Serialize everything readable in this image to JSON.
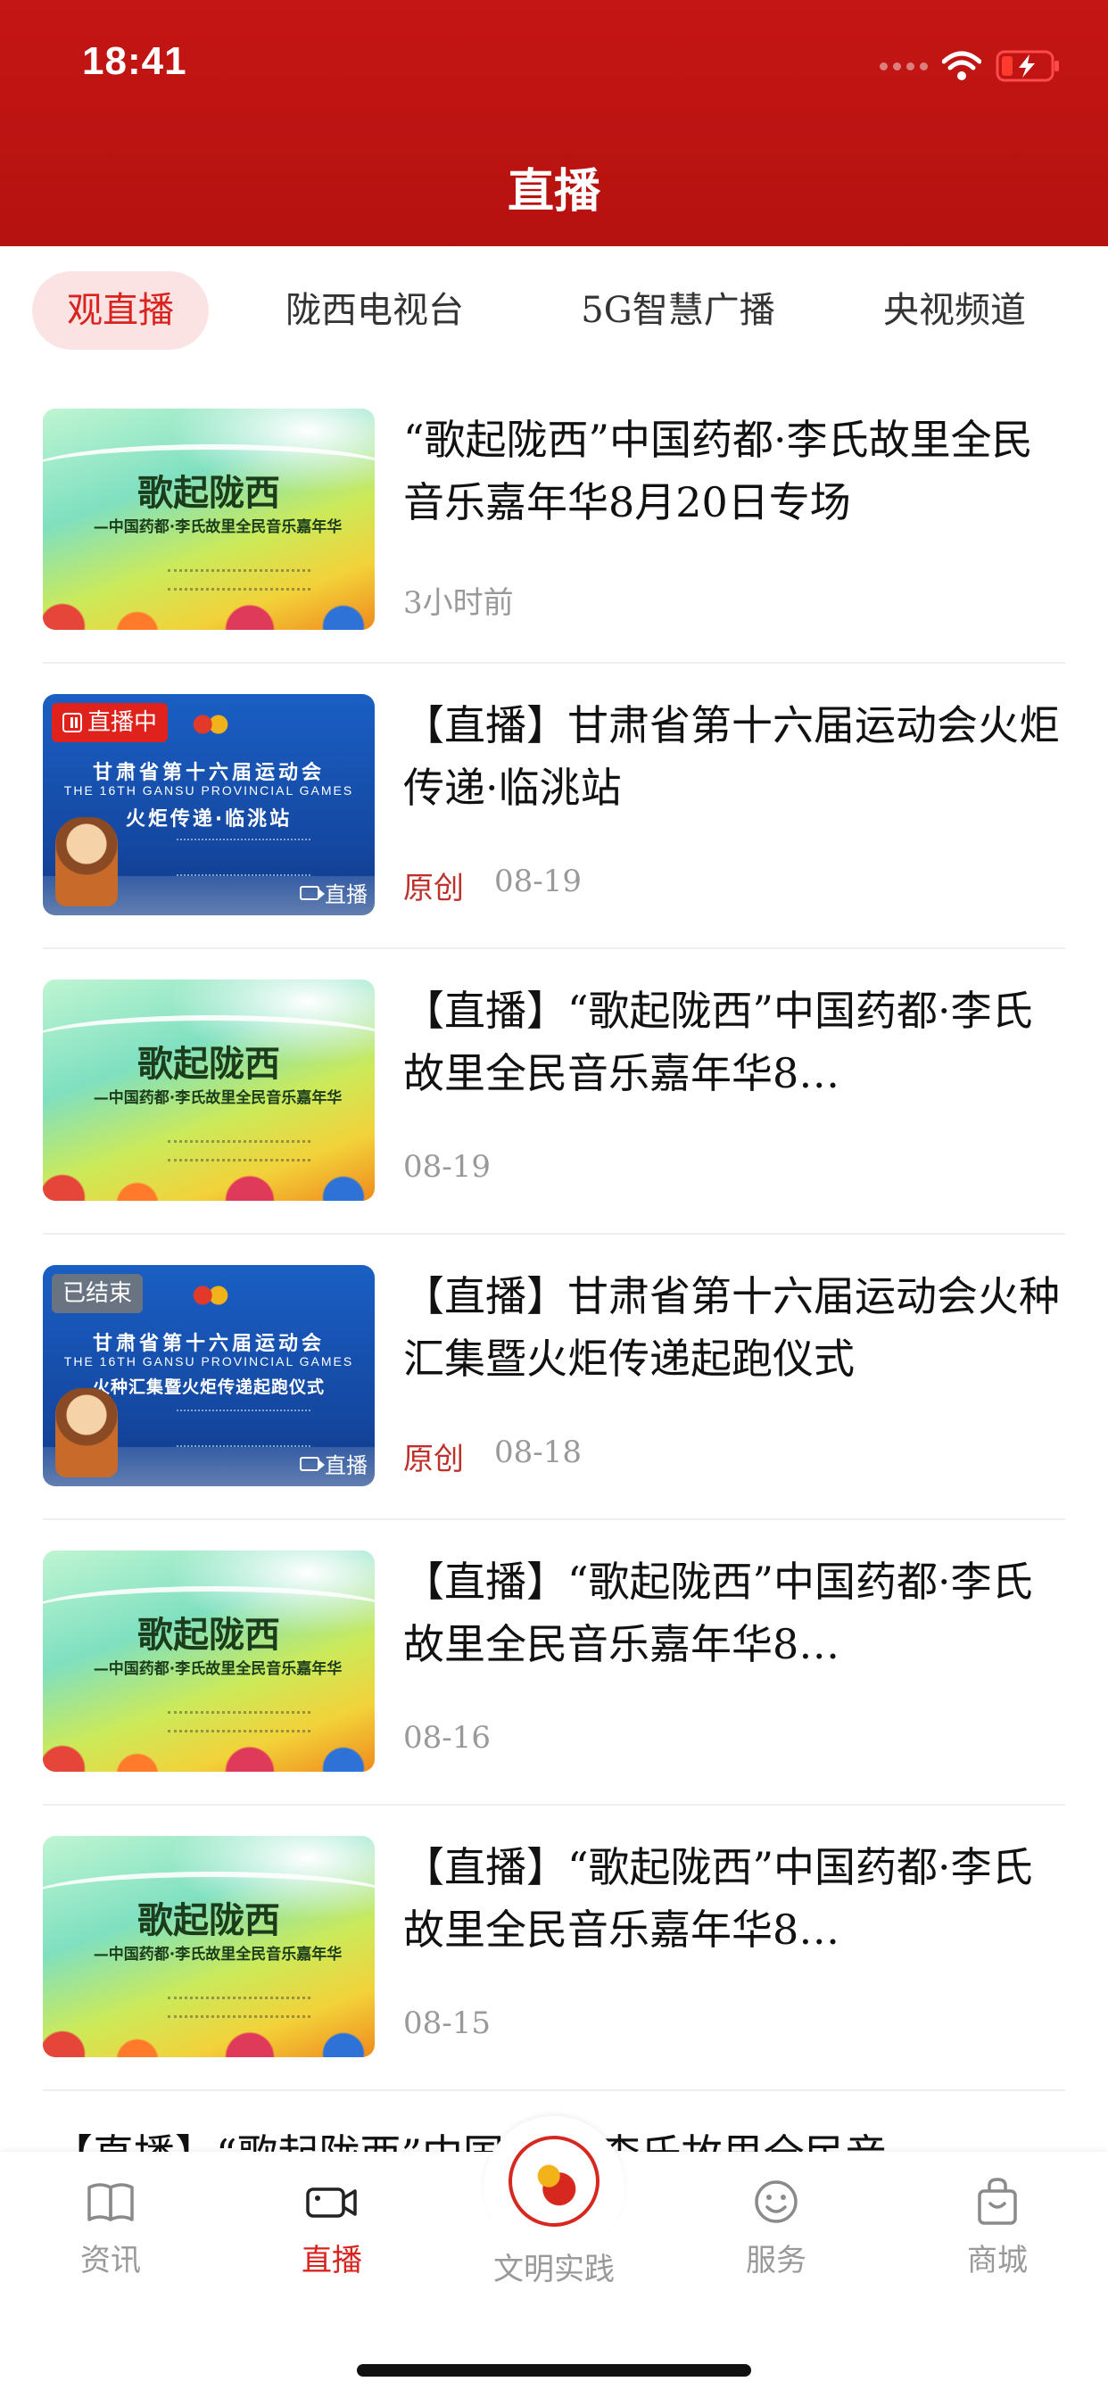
{
  "status_bar": {
    "time": "18:41"
  },
  "header": {
    "title": "直播"
  },
  "tabs": [
    {
      "label": "观直播",
      "active": true
    },
    {
      "label": "陇西电视台",
      "active": false
    },
    {
      "label": "5G智慧广播",
      "active": false
    },
    {
      "label": "央视频道",
      "active": false
    }
  ],
  "items": [
    {
      "title": "“歌起陇西”中国药都·李氏故里全民音乐嘉年华8月20日专场",
      "time": "3小时前",
      "origin": "",
      "thumb": {
        "style": "green",
        "main": "歌起陇西",
        "sub": "—中国药都·李氏故里全民音乐嘉年华"
      }
    },
    {
      "title": "【直播】甘肃省第十六届运动会火炬传递·临洮站",
      "time": "08-19",
      "origin": "原创",
      "badge": "直播中",
      "corner": "直播",
      "thumb": {
        "style": "blue",
        "line1": "甘肃省第十六届运动会",
        "line2": "THE 16TH GANSU PROVINCIAL GAMES",
        "line3": "火炬传递·临洮站"
      }
    },
    {
      "title": "【直播】“歌起陇西”中国药都·李氏故里全民音乐嘉年华8…",
      "time": "08-19",
      "origin": "",
      "thumb": {
        "style": "green",
        "main": "歌起陇西",
        "sub": "—中国药都·李氏故里全民音乐嘉年华"
      }
    },
    {
      "title": "【直播】甘肃省第十六届运动会火种汇集暨火炬传递起跑仪式",
      "time": "08-18",
      "origin": "原创",
      "badge": "已结束",
      "corner": "直播",
      "thumb": {
        "style": "blue",
        "line1": "甘肃省第十六届运动会",
        "line2": "THE 16TH GANSU PROVINCIAL GAMES",
        "line3": "火种汇集暨火炬传递起跑仪式"
      }
    },
    {
      "title": "【直播】“歌起陇西”中国药都·李氏故里全民音乐嘉年华8…",
      "time": "08-16",
      "origin": "",
      "thumb": {
        "style": "green",
        "main": "歌起陇西",
        "sub": "—中国药都·李氏故里全民音乐嘉年华"
      }
    },
    {
      "title": "【直播】“歌起陇西”中国药都·李氏故里全民音乐嘉年华8…",
      "time": "08-15",
      "origin": "",
      "thumb": {
        "style": "green",
        "main": "歌起陇西",
        "sub": "—中国药都·李氏故里全民音乐嘉年华"
      }
    }
  ],
  "partial_item": {
    "title": "【直播】“歌起陇西”中国药都·李氏故里全民音"
  },
  "bottom_nav": [
    {
      "label": "资讯",
      "icon": "book-icon",
      "active": false
    },
    {
      "label": "直播",
      "icon": "video-camera-icon",
      "active": true
    },
    {
      "label": "文明实践",
      "icon": "civilization-logo-icon",
      "active": false
    },
    {
      "label": "服务",
      "icon": "smiley-icon",
      "active": false
    },
    {
      "label": "商城",
      "icon": "shopping-bag-icon",
      "active": false
    }
  ],
  "colors": {
    "brand_red": "#c41614",
    "active_red": "#d9231f",
    "origin_red": "#c0302a"
  }
}
